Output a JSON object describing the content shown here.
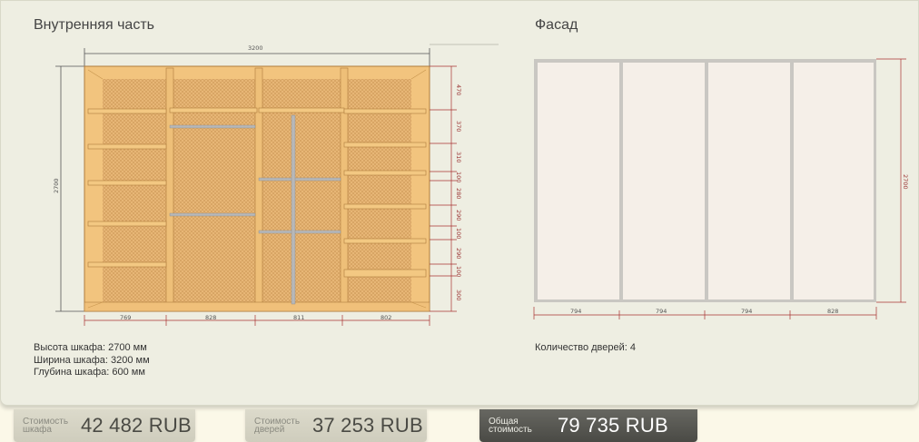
{
  "interior": {
    "title": "Внутренняя часть",
    "width_label": "3200",
    "height_label": "2700",
    "bottom_dims": [
      "769",
      "828",
      "811",
      "802"
    ],
    "right_dims": [
      "470",
      "370",
      "310",
      "100",
      "280",
      "290",
      "100",
      "290",
      "100",
      "300"
    ]
  },
  "facade": {
    "title": "Фасад",
    "height_label": "2700",
    "bottom_dims": [
      "794",
      "794",
      "794",
      "828"
    ]
  },
  "specs": {
    "height": "Высота шкафа: 2700 мм",
    "width": "Ширина шкафа: 3200 мм",
    "depth": "Глубина шкафа: 600 мм"
  },
  "door_count": "Количество дверей: 4",
  "prices": {
    "cabinet_label_1": "Стоимость",
    "cabinet_label_2": "шкафа",
    "cabinet_value": "42 482  RUB",
    "doors_label_1": "Стоимость",
    "doors_label_2": "дверей",
    "doors_value": "37 253  RUB",
    "total_label_1": "Общая",
    "total_label_2": "стоимость",
    "total_value": "79 735  RUB"
  },
  "colors": {
    "wood": "#f2c47e",
    "wood_dark": "#c8964e",
    "dimension_red": "#a83232",
    "facade_panel": "#f5efe8"
  }
}
